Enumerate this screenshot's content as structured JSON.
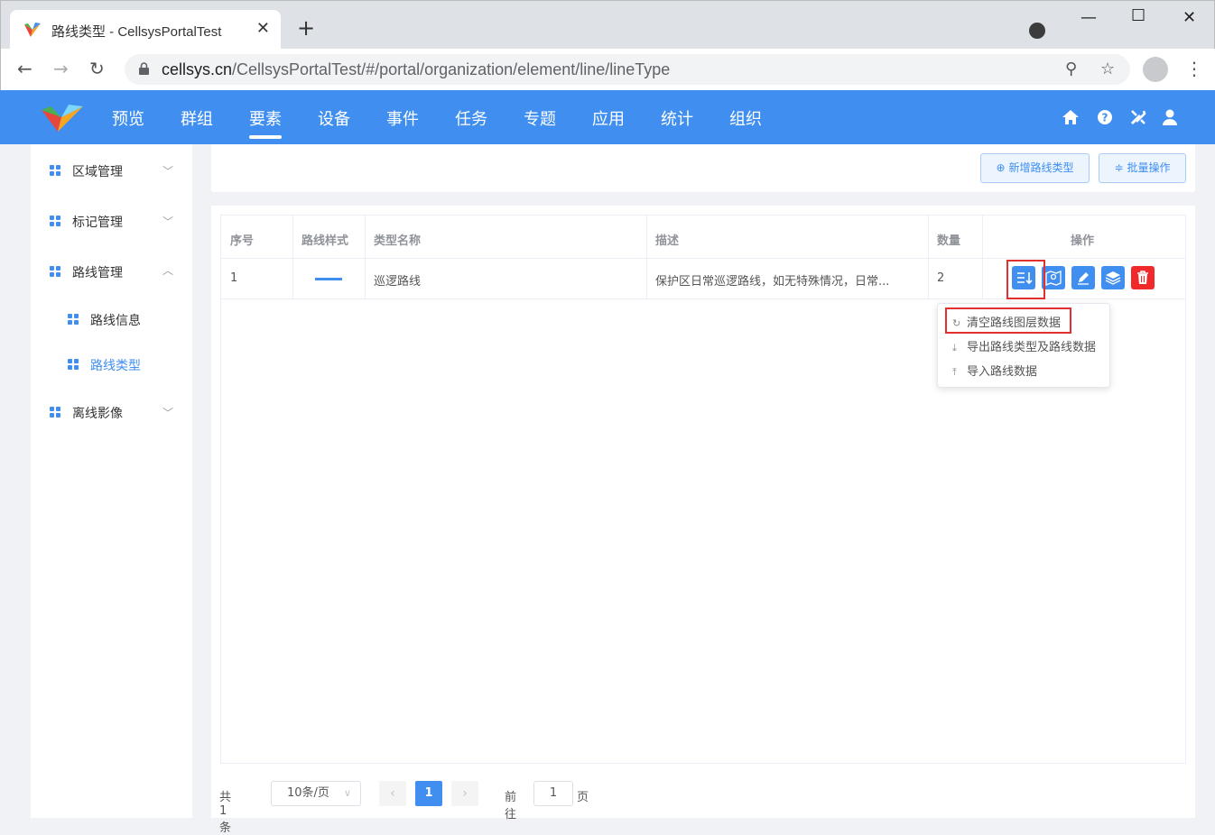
{
  "browser": {
    "tab_title": "路线类型 - CellsysPortalTest",
    "url_host": "cellsys.cn",
    "url_path": "/CellsysPortalTest/#/portal/organization/element/line/lineType"
  },
  "nav": {
    "items": [
      "预览",
      "群组",
      "要素",
      "设备",
      "事件",
      "任务",
      "专题",
      "应用",
      "统计",
      "组织"
    ],
    "active": "要素"
  },
  "sidebar": {
    "items": [
      {
        "label": "区域管理",
        "expanded": false
      },
      {
        "label": "标记管理",
        "expanded": false
      },
      {
        "label": "路线管理",
        "expanded": true
      },
      {
        "label": "路线信息",
        "sub": true
      },
      {
        "label": "路线类型",
        "sub": true,
        "active": true
      },
      {
        "label": "离线影像",
        "expanded": false
      }
    ]
  },
  "toolbar": {
    "add_label": "新增路线类型",
    "batch_label": "批量操作"
  },
  "table": {
    "headers": [
      "序号",
      "路线样式",
      "类型名称",
      "描述",
      "数量",
      "操作"
    ],
    "rows": [
      {
        "index": "1",
        "style_color": "#3f8ef0",
        "name": "巡逻路线",
        "desc": "保护区日常巡逻路线，如无特殊情况，日常...",
        "count": "2"
      }
    ]
  },
  "dropdown": {
    "items": [
      "清空路线图层数据",
      "导出路线类型及路线数据",
      "导入路线数据"
    ]
  },
  "pagination": {
    "total": "共 1 条",
    "page_size": "10条/页",
    "current": "1",
    "goto_prefix": "前往",
    "goto_value": "1",
    "goto_suffix": "页"
  },
  "colors": {
    "accent": "#3f8ef0",
    "danger": "#f02a2a",
    "highlight": "#e03030"
  }
}
